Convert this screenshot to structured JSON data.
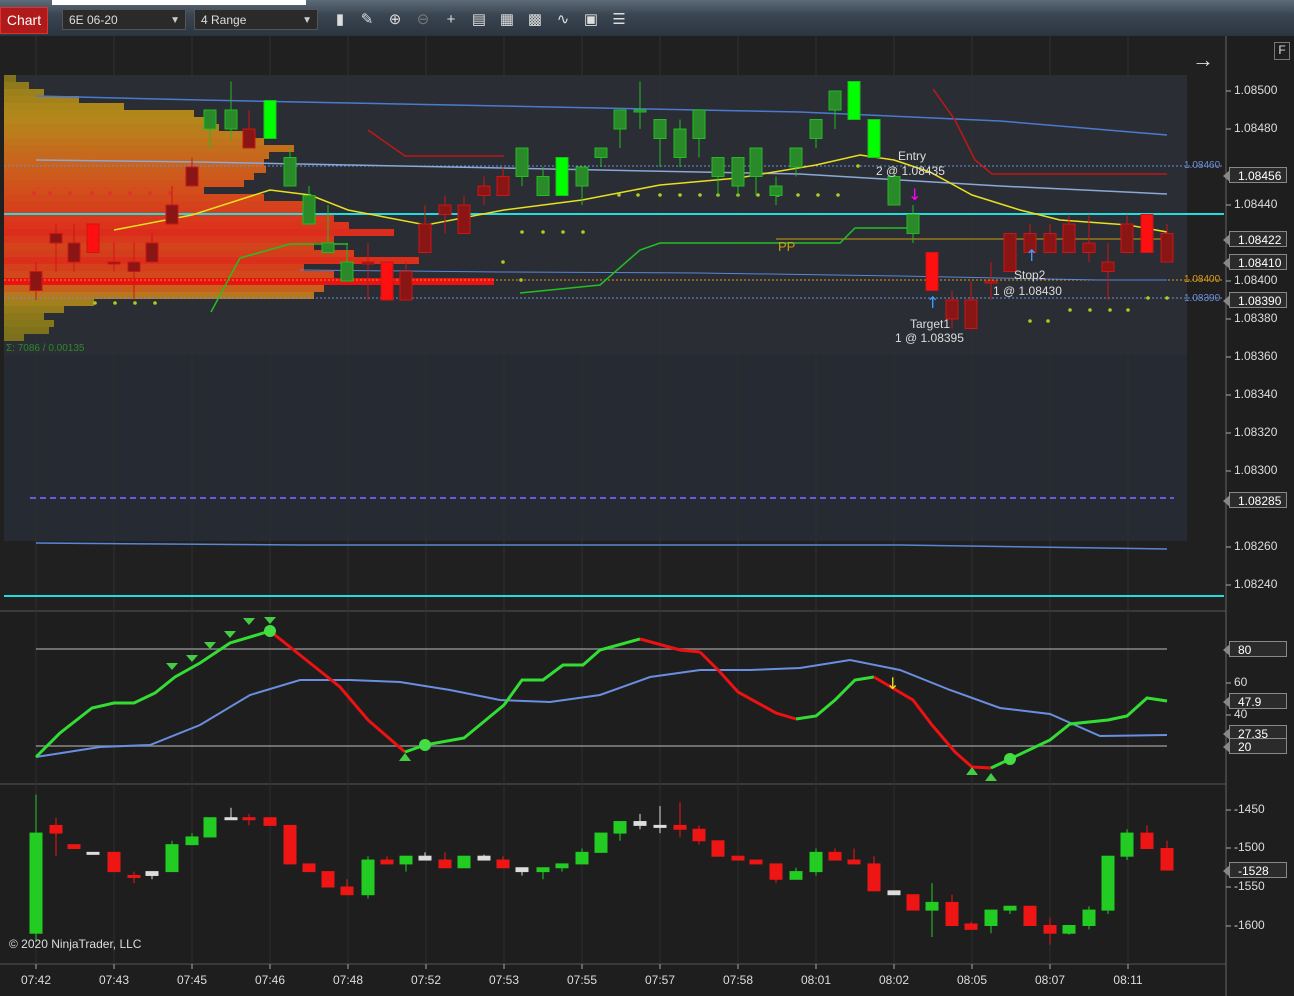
{
  "toolbar": {
    "chart_tab": "Chart",
    "instrument": "6E 06-20",
    "period": "4 Range",
    "icons": [
      "bar-type-icon",
      "draw-pencil-icon",
      "zoom-in-icon",
      "zoom-out-icon",
      "crosshair-icon",
      "data-box-icon",
      "chart-properties-icon",
      "strategies-icon",
      "templates-icon",
      "menu-icon"
    ]
  },
  "price_panel": {
    "y_ticks": [
      "1.08500",
      "1.08480",
      "1.08440",
      "1.08400",
      "1.08380",
      "1.08360",
      "1.08340",
      "1.08320",
      "1.08300",
      "1.08260",
      "1.08240"
    ],
    "price_labels": [
      {
        "text": "1.08456",
        "color": "#ffffff"
      },
      {
        "text": "1.08422",
        "color": "#ffffff"
      },
      {
        "text": "1.08410",
        "color": "#ffffff"
      },
      {
        "text": "1.08390",
        "color": "#ffffff"
      },
      {
        "text": "1.08285",
        "color": "#ffffff"
      }
    ],
    "small_labels": [
      {
        "text": "1.08460",
        "color": "#6c8ed6"
      },
      {
        "text": "1.08400",
        "color": "#d99a1a"
      },
      {
        "text": "1.08390",
        "color": "#6c8ed6"
      }
    ],
    "volume_profile_label": "Σ: 7086 / 0.00135",
    "pp_label": "PP",
    "orders": {
      "entry": {
        "title": "Entry",
        "detail": "2 @ 1.08435"
      },
      "target": {
        "title": "Target1",
        "detail": "1 @ 1.08395"
      },
      "stop": {
        "title": "Stop2",
        "detail": "1 @ 1.08430"
      }
    },
    "f_button": "F"
  },
  "osc_panel": {
    "y_ticks": [
      "60",
      "40"
    ],
    "labels": [
      "80",
      "47.9",
      "27.35",
      "20"
    ]
  },
  "delta_panel": {
    "y_ticks": [
      "-1450",
      "-1500",
      "-1550",
      "-1600"
    ],
    "label": "-1528"
  },
  "x_axis": [
    "07:42",
    "07:43",
    "07:45",
    "07:46",
    "07:48",
    "07:52",
    "07:53",
    "07:55",
    "07:57",
    "07:58",
    "08:01",
    "08:02",
    "08:05",
    "08:07",
    "08:11"
  ],
  "copyright": "© 2020 NinjaTrader, LLC",
  "colors": {
    "up": "#22cc22",
    "down": "#e01010",
    "cyan": "#22dddd",
    "yellow": "#e8e020",
    "blue": "#5a86d8"
  }
}
